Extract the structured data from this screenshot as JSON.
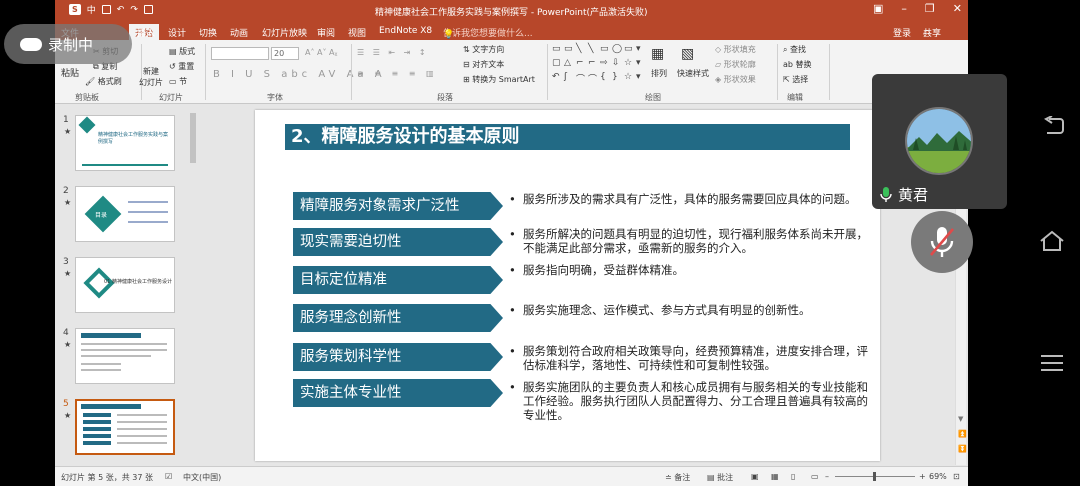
{
  "window": {
    "title": "精神健康社会工作服务实践与案例撰写 - PowerPoint(产品激活失败)",
    "login": "登录",
    "share": "共享"
  },
  "qa": {
    "logo": "S",
    "label": "中"
  },
  "tabs": {
    "file": "文件",
    "home": "开始",
    "insert": "插入",
    "design": "设计",
    "transitions": "切换",
    "animations": "动画",
    "slideshow": "幻灯片放映",
    "review": "审阅",
    "view": "视图",
    "endnote": "EndNote X8",
    "tellme": "告诉我您想要做什么..."
  },
  "ribbon": {
    "paste": "粘贴",
    "cut": "剪切",
    "copy": "复制",
    "format_painter": "格式刷",
    "new_slide": "新建\n幻灯片",
    "layout": "版式",
    "reset": "重置",
    "section": "节",
    "font_size": "20",
    "text_direction": "文字方向",
    "align_text": "对齐文本",
    "smartart": "转换为 SmartArt",
    "arrange": "排列",
    "quick_styles": "快速样式",
    "shape_fill": "形状填充",
    "shape_outline": "形状轮廓",
    "shape_effects": "形状效果",
    "find": "查找",
    "replace": "替换",
    "select": "选择",
    "groups": {
      "clipboard": "剪贴板",
      "slides": "幻灯片",
      "font": "字体",
      "paragraph": "段落",
      "drawing": "绘图",
      "editing": "编辑"
    }
  },
  "slides": [
    {
      "num": "1",
      "star": "★",
      "caption": "精神健康社会工作服务实践与案例撰写"
    },
    {
      "num": "2",
      "star": "★",
      "caption": "目录"
    },
    {
      "num": "3",
      "star": "★",
      "caption": "01 精神健康社会工作服务设计"
    },
    {
      "num": "4",
      "star": "★",
      "caption": ""
    },
    {
      "num": "5",
      "star": "★",
      "caption": ""
    }
  ],
  "slide": {
    "heading": "2、精障服务设计的基本原则",
    "principles": [
      {
        "label": "精障服务对象需求广泛性",
        "bullet": "•",
        "desc": "服务所涉及的需求具有广泛性，具体的服务需要回应具体的问题。"
      },
      {
        "label": "现实需要迫切性",
        "bullet": "•",
        "desc": "服务所解决的问题具有明显的迫切性，现行福利服务体系尚未开展，不能满足此部分需求，亟需新的服务的介入。"
      },
      {
        "label": "目标定位精准",
        "bullet": "•",
        "desc": "服务指向明确，受益群体精准。"
      },
      {
        "label": "服务理念创新性",
        "bullet": "•",
        "desc": "服务实施理念、运作模式、参与方式具有明显的创新性。"
      },
      {
        "label": "服务策划科学性",
        "bullet": "•",
        "desc": "服务策划符合政府相关政策导向，经费预算精准，进度安排合理，评估标准科学，落地性、可持续性和可复制性较强。"
      },
      {
        "label": "实施主体专业性",
        "bullet": "•",
        "desc": "服务实施团队的主要负责人和核心成员拥有与服务相关的专业技能和工作经验。服务执行团队人员配置得力、分工合理且普遍具有较高的专业性。"
      }
    ]
  },
  "status": {
    "slide_info": "幻灯片 第 5 张，共 37 张",
    "language": "中文(中国)",
    "notes": "备注",
    "comments": "批注",
    "zoom": "69%"
  },
  "overlay": {
    "recording": "录制中",
    "participant": "黄君"
  },
  "colors": {
    "accent": "#b7472a",
    "slide_blue": "#226a85"
  }
}
